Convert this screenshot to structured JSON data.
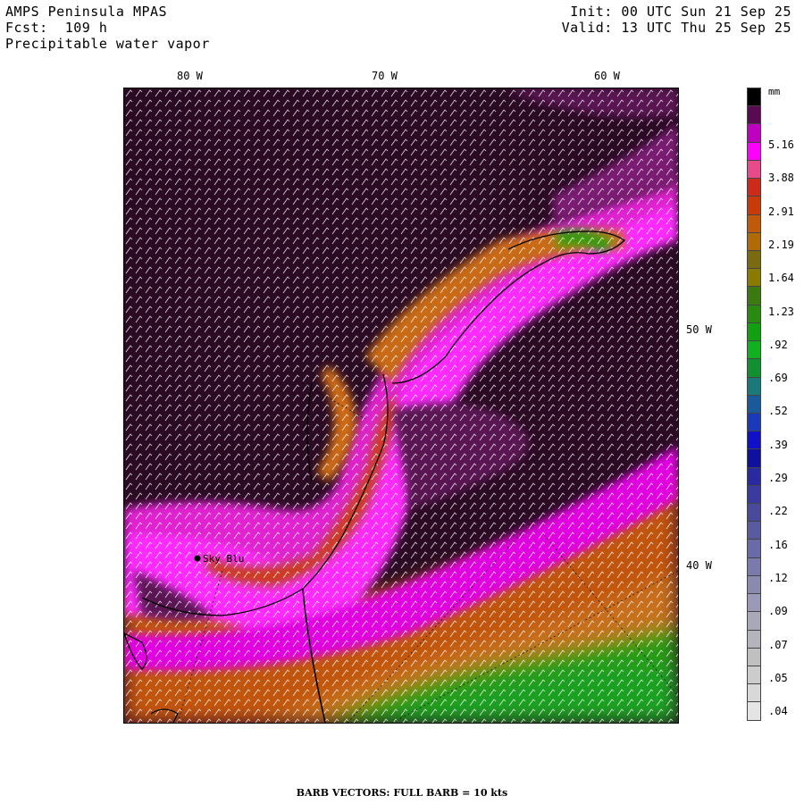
{
  "header": {
    "line1_left": "AMPS Peninsula MPAS",
    "line2_left": "Fcst:  109 h",
    "line3_left": "Precipitable water vapor",
    "line1_right": "Init: 00 UTC Sun 21 Sep 25",
    "line2_right": "Valid: 13 UTC Thu 25 Sep 25"
  },
  "map": {
    "lon_labels": [
      "80 W",
      "70 W",
      "60 W"
    ],
    "lat_labels": [
      "50 W",
      "40 W"
    ],
    "station": "Sky Blu"
  },
  "colorbar": {
    "unit": "mm",
    "labels": [
      "5.16",
      "3.88",
      "2.91",
      "2.19",
      "1.64",
      "1.23",
      ".92",
      ".69",
      ".52",
      ".39",
      ".29",
      ".22",
      ".16",
      ".12",
      ".09",
      ".07",
      ".05",
      ".04"
    ],
    "colors": [
      "#000000",
      "#5a0a52",
      "#c000c0",
      "#ff00ff",
      "#e84a8a",
      "#cc2a1a",
      "#c83a08",
      "#c05a08",
      "#b06a08",
      "#7a6a10",
      "#8a7a00",
      "#3a7a10",
      "#2a8a10",
      "#10a010",
      "#10b020",
      "#109030",
      "#1a7a7a",
      "#1a5a9a",
      "#1a3aba",
      "#1010c8",
      "#1010a0",
      "#2a2aa0",
      "#3a3aa0",
      "#4a4a9a",
      "#5a5aa0",
      "#6a6aa8",
      "#7a7aac",
      "#8a8ab0",
      "#9a9ab8",
      "#a8a8b8",
      "#b4b4bc",
      "#c0c0c0",
      "#cccccc",
      "#d8d8d8",
      "#e4e4e4"
    ]
  },
  "footer": "BARB VECTORS:  FULL BARB = 10 kts"
}
